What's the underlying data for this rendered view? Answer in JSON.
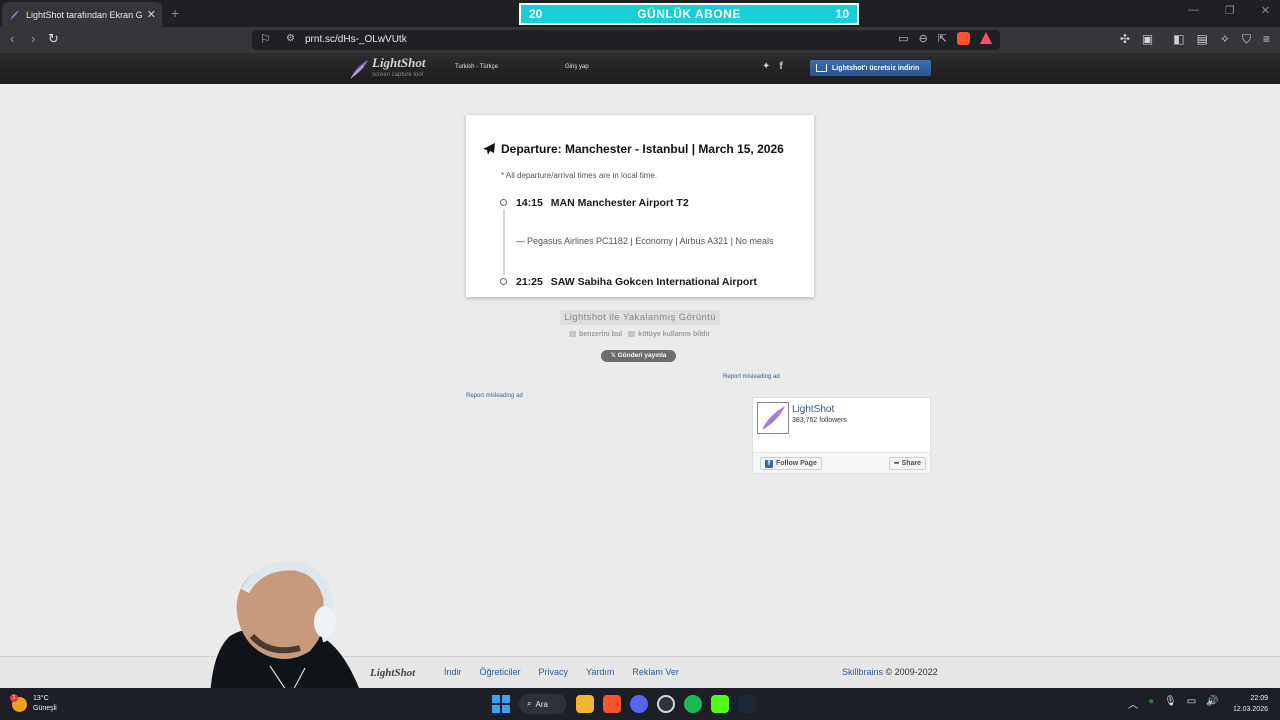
{
  "browser": {
    "tab_title": "LightShot tarafından Ekran Görü",
    "tab_close": "✕",
    "new_tab": "+",
    "url": "prnt.sc/dHs-_OLwVUtk",
    "subscriber_banner": {
      "left": "20",
      "title": "GÜNLÜK ABONE",
      "right": "10"
    },
    "colors": {
      "banner": "#17cfd8",
      "toolbar": "#35363a"
    }
  },
  "lightshot_header": {
    "logo_name": "LightShot",
    "logo_tagline": "screen capture tool",
    "language": "Turkish - Türkçe",
    "login": "Giriş yap",
    "download_button": "Lightshot'ı ücretsiz indirin"
  },
  "screenshot": {
    "title": "Departure: Manchester - Istanbul | March 15, 2026",
    "note": "* All departure/arrival times are in local time.",
    "departure": {
      "time": "14:15",
      "airport": "MAN Manchester Airport T2"
    },
    "flight_info": "Pegasus Airlines PC1182 | Economy | Airbus A321 | No meals",
    "arrival": {
      "time": "21:25",
      "airport": "SAW Sabiha Gokcen International Airport"
    }
  },
  "actions": {
    "captured_label": "Lightshot ile Yakalanmış Görüntü",
    "find_similar": "benzerini bul",
    "report_abuse": "kötüye kullanım bildir",
    "tweet": "Gönderi yayınla",
    "report_ad_1": "Report misleading ad",
    "report_ad_2": "Report misleading ad"
  },
  "facebook_widget": {
    "page_name": "LightShot",
    "followers": "383,762 followers",
    "follow": "Follow Page",
    "share": "Share"
  },
  "footer": {
    "logo": "LightShot",
    "links": [
      "İndir",
      "Öğreticiler",
      "Privacy",
      "Yardım",
      "Reklam Ver"
    ],
    "company": "Skillbrains",
    "copyright": " © 2009-2022"
  },
  "taskbar": {
    "temperature": "13°C",
    "weather": "Güneşli",
    "weather_badge": "1",
    "search": "Ara",
    "time": "22:09",
    "date": "12.03.2026"
  }
}
